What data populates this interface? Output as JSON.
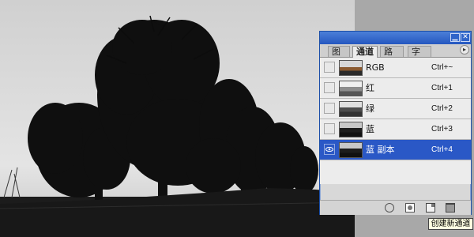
{
  "panel": {
    "tabs": [
      {
        "label": "图层",
        "active": false
      },
      {
        "label": "通道",
        "active": true
      },
      {
        "label": "路径",
        "active": false
      },
      {
        "label": "字符",
        "active": false
      }
    ],
    "menu_arrow": "▸",
    "min_glyph": "▁",
    "close_glyph": "✕",
    "channels": [
      {
        "name": "RGB",
        "shortcut": "Ctrl+~",
        "visible": false,
        "selected": false,
        "thumb": "color"
      },
      {
        "name": "红",
        "shortcut": "Ctrl+1",
        "visible": false,
        "selected": false,
        "thumb": "light"
      },
      {
        "name": "绿",
        "shortcut": "Ctrl+2",
        "visible": false,
        "selected": false,
        "thumb": "mid"
      },
      {
        "name": "蓝",
        "shortcut": "Ctrl+3",
        "visible": false,
        "selected": false,
        "thumb": "dark"
      },
      {
        "name": "蓝 副本",
        "shortcut": "Ctrl+4",
        "visible": true,
        "selected": true,
        "thumb": "dark"
      }
    ],
    "bottom_icons": [
      "load-selection-icon",
      "save-selection-icon",
      "new-channel-icon",
      "trash-icon"
    ]
  },
  "tooltip": {
    "text": "创建新通道"
  },
  "colors": {
    "accent": "#2a58c6",
    "titlebar": "#2557c0",
    "tooltip_bg": "#ffffe1"
  }
}
